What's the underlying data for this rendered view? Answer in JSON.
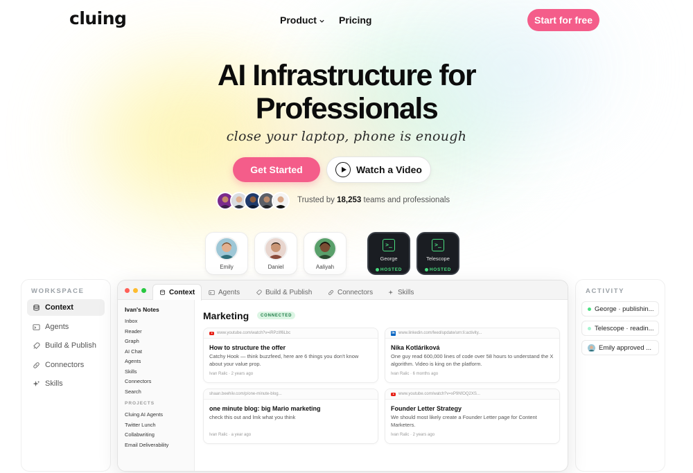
{
  "brand": {
    "logo": "cluing",
    "accent": "#f45d8a"
  },
  "nav": {
    "product": "Product",
    "pricing": "Pricing",
    "cta": "Start for free"
  },
  "hero": {
    "title_line1": "AI Infrastructure for",
    "title_line2": "Professionals",
    "tagline": "close your laptop, phone is enough",
    "primary_button": "Get Started",
    "secondary_button": "Watch a Video",
    "trust_prefix": "Trusted by",
    "trust_count": "18,253",
    "trust_suffix": "teams and professionals"
  },
  "agents": [
    {
      "name": "Emily"
    },
    {
      "name": "Daniel"
    },
    {
      "name": "Aaliyah"
    }
  ],
  "hosted_agents": [
    {
      "name": "George",
      "status": "HOSTED"
    },
    {
      "name": "Telescope",
      "status": "HOSTED"
    }
  ],
  "workspace": {
    "heading": "WORKSPACE",
    "items": [
      {
        "label": "Context",
        "icon": "database-icon",
        "active": true
      },
      {
        "label": "Agents",
        "icon": "terminal-icon"
      },
      {
        "label": "Build & Publish",
        "icon": "rocket-icon"
      },
      {
        "label": "Connectors",
        "icon": "link-icon"
      },
      {
        "label": "Skills",
        "icon": "sparkles-icon"
      }
    ]
  },
  "activity": {
    "heading": "ACTIVITY",
    "items": [
      {
        "text": "George · publishin...",
        "dot": "#4ade80"
      },
      {
        "text": "Telescope · readin...",
        "dot": "#a7f3d0"
      },
      {
        "text": "Emily approved ...",
        "avatar": true
      }
    ]
  },
  "app": {
    "tabs": [
      "Context",
      "Agents",
      "Build & Publish",
      "Connectors",
      "Skills"
    ],
    "notes": {
      "heading": "Ivan's Notes",
      "items": [
        "Inbox",
        "Reader",
        "Graph",
        "AI Chat",
        "Agents",
        "Skills",
        "Connectors",
        "Search"
      ],
      "projects_heading": "PROJECTS",
      "projects": [
        "Cluing AI Agents",
        "Twitter Lunch",
        "Collabwriting",
        "Email Deliverability"
      ]
    },
    "section_title": "Marketing",
    "section_badge": "CONNECTED",
    "cards": [
      {
        "source": "youtube",
        "url": "www.youtube.com/watch?v=iRPzIlf6Lbc",
        "title": "How to structure the offer",
        "body": "Catchy Hook — think buzzfeed, here are 6 things you don't know about your value prop.",
        "meta": "Ivan Ralic · 2 years ago"
      },
      {
        "source": "linkedin",
        "url": "www.linkedin.com/feed/update/urn:li:activity...",
        "title": "Nika Kotláriková",
        "body": "One guy read 600,000 lines of code over 58 hours to understand the X algorithm. Video is king on the platform.",
        "meta": "Ivan Ralic · 6 months ago"
      },
      {
        "source": "web",
        "url": "shaan.beehiiv.com/p/one-minute-blog...",
        "title": "one minute blog: big Mario marketing",
        "body": "check this out and lmk what you think",
        "meta": "Ivan Ralic · a year ago"
      },
      {
        "source": "youtube",
        "url": "www.youtube.com/watch?v=xP9NfOQ2XS...",
        "title": "Founder Letter Strategy",
        "body": "We should most likely create a Founder Letter page for Content Marketers.",
        "meta": "Ivan Ralic · 2 years ago"
      }
    ]
  }
}
